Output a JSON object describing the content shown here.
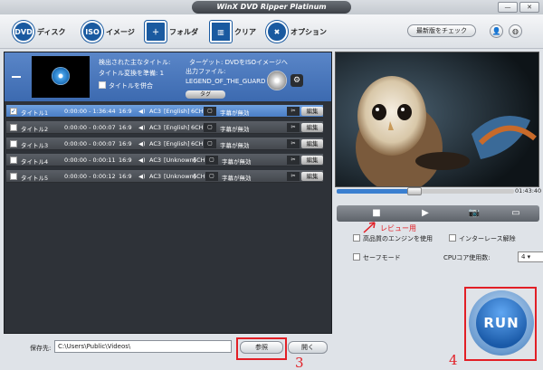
{
  "window": {
    "title": "WinX DVD Ripper Platinum",
    "min_label": "—",
    "close_label": "✕"
  },
  "toolbar": {
    "disc_label": "ディスク",
    "disc_icon_text": "DVD",
    "image_label": "イメージ",
    "image_icon_text": "ISO",
    "folder_label": "フォルダ",
    "clear_label": "クリア",
    "options_label": "オプション",
    "update_label": "最新版をチェック",
    "user_icon": "👤",
    "globe_icon": "◍"
  },
  "source": {
    "main_title_label": "検出された主なタイトル:",
    "target_label": "ターゲット: DVDをISOイメージへ",
    "ready_label": "タイトル変換を準備: 1",
    "output_label": "出力ファイル:",
    "merge_label": "タイトルを併合",
    "filename": "LEGEND_OF_THE_GUARD",
    "tag_label": "タグ",
    "gear_icon": "⚙"
  },
  "titles": [
    {
      "name": "タイトル1",
      "time": "0:00:00 - 1:36:44",
      "aspect": "16:9",
      "audio": "AC3",
      "lang": "[English]",
      "ch": "6CH",
      "sub": "字幕が無効",
      "edit": "編集",
      "checked": "✓"
    },
    {
      "name": "タイトル2",
      "time": "0:00:00 - 0:00:07",
      "aspect": "16:9",
      "audio": "AC3",
      "lang": "[English]",
      "ch": "6CH",
      "sub": "字幕が無効",
      "edit": "編集",
      "checked": ""
    },
    {
      "name": "タイトル3",
      "time": "0:00:00 - 0:00:07",
      "aspect": "16:9",
      "audio": "AC3",
      "lang": "[English]",
      "ch": "6CH",
      "sub": "字幕が無効",
      "edit": "編集",
      "checked": ""
    },
    {
      "name": "タイトル4",
      "time": "0:00:00 - 0:00:11",
      "aspect": "16:9",
      "audio": "AC3",
      "lang": "[Unknown]",
      "ch": "6CH",
      "sub": "字幕が無効",
      "edit": "編集",
      "checked": ""
    },
    {
      "name": "タイトル5",
      "time": "0:00:00 - 0:00:12",
      "aspect": "16:9",
      "audio": "AC3",
      "lang": "[Unknown]",
      "ch": "6CH",
      "sub": "字幕が無効",
      "edit": "編集",
      "checked": ""
    }
  ],
  "output": {
    "save_label": "保存先:",
    "path": "C:\\Users\\Public\\Videos\\",
    "browse_label": "参照",
    "open_label": "開く"
  },
  "preview": {
    "time": "01:43:40",
    "seek_progress": 0.44,
    "annotation": "レビュー用",
    "stop_icon": "■",
    "play_icon": "▶",
    "snapshot_icon": "📷",
    "folder_icon": "▭"
  },
  "settings": {
    "hq_engine": "高品質のエンジンを使用",
    "deinterlace": "インターレース解除",
    "safe_mode": "セーフモード",
    "cpu_label": "CPUコア使用数:",
    "cpu_value": "4 ▾"
  },
  "run": {
    "label": "RUN"
  },
  "annotations": {
    "num3": "3",
    "num4": "4"
  }
}
